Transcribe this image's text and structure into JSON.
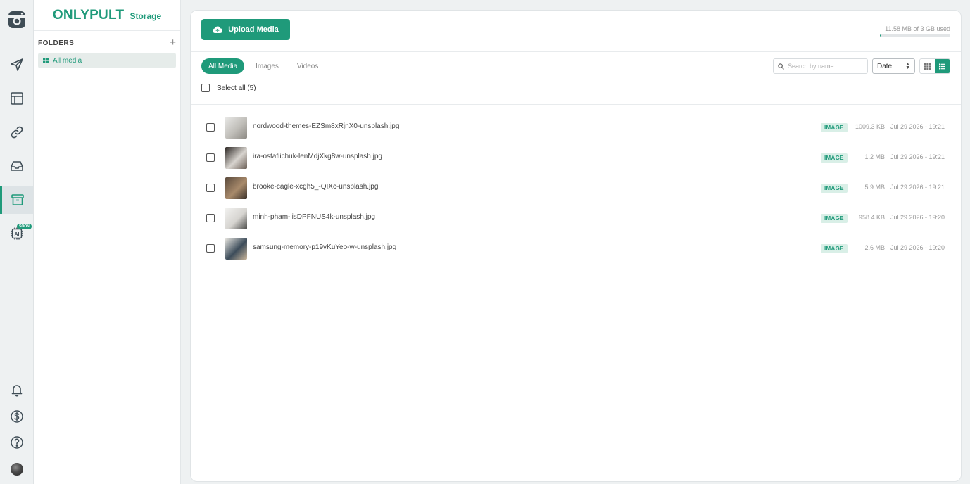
{
  "brand": {
    "name": "ONLYPULT",
    "section": "Storage"
  },
  "rail": {
    "soon_badge": "SOON",
    "ai_icon_text": "AI",
    "top_items": [
      "logo-icon",
      "send-icon",
      "layout-icon",
      "link-icon",
      "inbox-icon",
      "archive-icon",
      "ai-chip-icon"
    ],
    "bottom_items": [
      "bell-icon",
      "dollar-icon",
      "help-icon",
      "avatar"
    ]
  },
  "folders": {
    "title": "FOLDERS",
    "add_label": "+",
    "items": [
      {
        "label": "All media",
        "active": true
      }
    ]
  },
  "toolbar": {
    "upload_label": "Upload Media",
    "storage_text": "11.58 MB of 3 GB used",
    "storage_used_fraction": 0.004
  },
  "tabs": [
    {
      "label": "All Media",
      "active": true
    },
    {
      "label": "Images",
      "active": false
    },
    {
      "label": "Videos",
      "active": false
    }
  ],
  "search": {
    "placeholder": "Search by name...",
    "value": ""
  },
  "sort": {
    "selected": "Date"
  },
  "view_mode": "list",
  "select_all_label": "Select all (5)",
  "files": [
    {
      "name": "nordwood-themes-EZSm8xRjnX0-unsplash.jpg",
      "type": "IMAGE",
      "size": "1009.3 KB",
      "date": "Jul 29 2026 - 19:21",
      "thumb_colors": [
        "#e8e8e6",
        "#bfbdb8",
        "#8d8a84"
      ]
    },
    {
      "name": "ira-ostafiichuk-lenMdjXkg8w-unsplash.jpg",
      "type": "IMAGE",
      "size": "1.2 MB",
      "date": "Jul 29 2026 - 19:21",
      "thumb_colors": [
        "#2b2623",
        "#d8d4cf",
        "#6b5f56"
      ]
    },
    {
      "name": "brooke-cagle-xcgh5_-QIXc-unsplash.jpg",
      "type": "IMAGE",
      "size": "5.9 MB",
      "date": "Jul 29 2026 - 19:21",
      "thumb_colors": [
        "#5a4a3c",
        "#a88a6b",
        "#3a3029"
      ]
    },
    {
      "name": "minh-pham-lisDPFNUS4k-unsplash.jpg",
      "type": "IMAGE",
      "size": "958.4 KB",
      "date": "Jul 29 2026 - 19:20",
      "thumb_colors": [
        "#f2f2f0",
        "#d6d4d0",
        "#4a4a48"
      ]
    },
    {
      "name": "samsung-memory-p19vKuYeo-w-unsplash.jpg",
      "type": "IMAGE",
      "size": "2.6 MB",
      "date": "Jul 29 2026 - 19:20",
      "thumb_colors": [
        "#e9e7e1",
        "#3c4c5a",
        "#c9b59a"
      ]
    }
  ],
  "colors": {
    "accent": "#1f9a7a",
    "badge_bg": "#d9efe7",
    "rail_bg": "#eef1f2"
  }
}
